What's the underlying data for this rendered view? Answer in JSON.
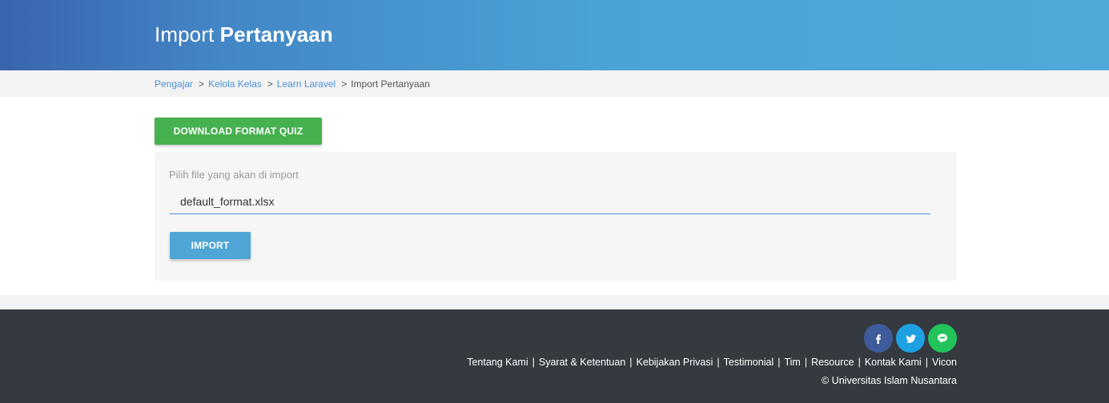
{
  "header": {
    "title_light": "Import",
    "title_bold": "Pertanyaan"
  },
  "breadcrumb": {
    "separator": ">",
    "items": [
      {
        "label": "Pengajar"
      },
      {
        "label": "Kelola Kelas"
      },
      {
        "label": "Learn Laravel"
      }
    ],
    "current": "Import Pertanyaan"
  },
  "main": {
    "download_button_label": "DOWNLOAD FORMAT QUIZ",
    "file_field_label": "Pilih file yang akan di import",
    "file_field_value": "default_format.xlsx",
    "import_button_label": "IMPORT"
  },
  "footer": {
    "social": [
      {
        "icon": "facebook-icon",
        "color": "#3f5b9b"
      },
      {
        "icon": "twitter-icon",
        "color": "#1da1e2"
      },
      {
        "icon": "line-icon",
        "color": "#22c35a"
      }
    ],
    "links": [
      {
        "label": "Tentang Kami"
      },
      {
        "label": "Syarat & Ketentuan"
      },
      {
        "label": "Kebijakan Privasi"
      },
      {
        "label": "Testimonial"
      },
      {
        "label": "Tim"
      },
      {
        "label": "Resource"
      },
      {
        "label": "Kontak Kami"
      },
      {
        "label": "Vicon"
      }
    ],
    "link_separator": "|",
    "copyright": "© Universitas Islam Nusantara"
  },
  "colors": {
    "header_gradient_start": "#3a63ae",
    "header_gradient_end": "#4ea9d8",
    "link_blue": "#4a90d9",
    "download_green": "#47b04f",
    "import_blue": "#4fa6d6",
    "footer_bg": "#353a40"
  }
}
